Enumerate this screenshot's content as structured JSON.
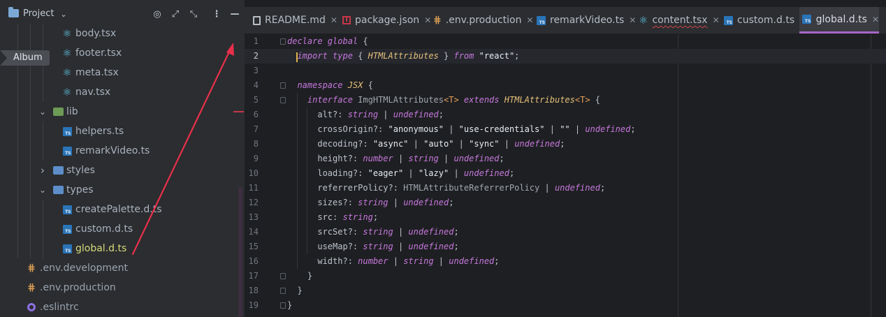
{
  "project": {
    "title": "Project",
    "header_icons": [
      "target-icon",
      "expand-icon",
      "collapse-icon",
      "more-icon",
      "minimize-icon"
    ]
  },
  "tooltip": {
    "label": "Album"
  },
  "tree": [
    {
      "label": "body.tsx",
      "icon": "react",
      "indent": 88
    },
    {
      "label": "footer.tsx",
      "icon": "react",
      "indent": 88
    },
    {
      "label": "meta.tsx",
      "icon": "react",
      "indent": 88
    },
    {
      "label": "nav.tsx",
      "icon": "react",
      "indent": 88
    },
    {
      "label": "lib",
      "icon": "folder-lib",
      "indent": 55,
      "chevron": "v"
    },
    {
      "label": "helpers.ts",
      "icon": "ts",
      "indent": 88
    },
    {
      "label": "remarkVideo.ts",
      "icon": "ts",
      "indent": 88
    },
    {
      "label": "styles",
      "icon": "folder-styles",
      "indent": 55,
      "chevron": ">"
    },
    {
      "label": "types",
      "icon": "folder-types",
      "indent": 55,
      "chevron": "v"
    },
    {
      "label": "createPalette.d.ts",
      "icon": "ts",
      "indent": 88
    },
    {
      "label": "custom.d.ts",
      "icon": "ts",
      "indent": 88
    },
    {
      "label": "global.d.ts",
      "icon": "ts",
      "indent": 88,
      "selected": true
    },
    {
      "label": ".env.development",
      "icon": "env",
      "indent": 37
    },
    {
      "label": ".env.production",
      "icon": "env",
      "indent": 37
    },
    {
      "label": ".eslintrc",
      "icon": "eslint",
      "indent": 37
    }
  ],
  "tabs": [
    {
      "label": "README.md",
      "icon": "readme"
    },
    {
      "label": "package.json",
      "icon": "npm"
    },
    {
      "label": ".env.production",
      "icon": "env"
    },
    {
      "label": "remarkVideo.ts",
      "icon": "ts"
    },
    {
      "label": "content.tsx",
      "icon": "react",
      "error": true
    },
    {
      "label": "custom.d.ts",
      "icon": "ts"
    },
    {
      "label": "global.d.ts",
      "icon": "ts",
      "active": true
    }
  ],
  "editor": {
    "current_line": 2,
    "lines": [
      [
        [
          "kw",
          "declare global"
        ],
        [
          "punc",
          " {"
        ]
      ],
      [
        [
          "punc",
          "  "
        ],
        [
          "kw",
          "import type"
        ],
        [
          "punc",
          " { "
        ],
        [
          "tyy",
          "HTMLAttributes"
        ],
        [
          "punc",
          " } "
        ],
        [
          "kw",
          "from"
        ],
        [
          "str",
          " \"react\""
        ],
        [
          "punc",
          ";"
        ]
      ],
      [],
      [
        [
          "punc",
          "  "
        ],
        [
          "kw",
          "namespace"
        ],
        [
          "punc",
          " "
        ],
        [
          "tyy",
          "JSX"
        ],
        [
          "punc",
          " {"
        ]
      ],
      [
        [
          "punc",
          "    "
        ],
        [
          "kw",
          "interface"
        ],
        [
          "punc",
          " "
        ],
        [
          "tyd",
          "ImgHTMLAttributes"
        ],
        [
          "gen",
          "<T>"
        ],
        [
          "punc",
          " "
        ],
        [
          "kw",
          "extends"
        ],
        [
          "punc",
          " "
        ],
        [
          "tyy",
          "HTMLAttributes"
        ],
        [
          "gen",
          "<T>"
        ],
        [
          "punc",
          " {"
        ]
      ],
      [
        [
          "punc",
          "      alt?: "
        ],
        [
          "ty",
          "string"
        ],
        [
          "punc",
          " | "
        ],
        [
          "ty",
          "undefined"
        ],
        [
          "punc",
          ";"
        ]
      ],
      [
        [
          "punc",
          "      crossOrigin?: "
        ],
        [
          "str",
          "\"anonymous\""
        ],
        [
          "punc",
          " | "
        ],
        [
          "str",
          "\"use-credentials\""
        ],
        [
          "punc",
          " | "
        ],
        [
          "str",
          "\"\""
        ],
        [
          "punc",
          " | "
        ],
        [
          "ty",
          "undefined"
        ],
        [
          "punc",
          ";"
        ]
      ],
      [
        [
          "punc",
          "      decoding?: "
        ],
        [
          "str",
          "\"async\""
        ],
        [
          "punc",
          " | "
        ],
        [
          "str",
          "\"auto\""
        ],
        [
          "punc",
          " | "
        ],
        [
          "str",
          "\"sync\""
        ],
        [
          "punc",
          " | "
        ],
        [
          "ty",
          "undefined"
        ],
        [
          "punc",
          ";"
        ]
      ],
      [
        [
          "punc",
          "      height?: "
        ],
        [
          "ty",
          "number"
        ],
        [
          "punc",
          " | "
        ],
        [
          "ty",
          "string"
        ],
        [
          "punc",
          " | "
        ],
        [
          "ty",
          "undefined"
        ],
        [
          "punc",
          ";"
        ]
      ],
      [
        [
          "punc",
          "      loading?: "
        ],
        [
          "str",
          "\"eager\""
        ],
        [
          "punc",
          " | "
        ],
        [
          "str",
          "\"lazy\""
        ],
        [
          "punc",
          " | "
        ],
        [
          "ty",
          "undefined"
        ],
        [
          "punc",
          ";"
        ]
      ],
      [
        [
          "punc",
          "      referrerPolicy?: "
        ],
        [
          "tyd",
          "HTMLAttributeReferrerPolicy"
        ],
        [
          "punc",
          " | "
        ],
        [
          "ty",
          "undefined"
        ],
        [
          "punc",
          ";"
        ]
      ],
      [
        [
          "punc",
          "      sizes?: "
        ],
        [
          "ty",
          "string"
        ],
        [
          "punc",
          " | "
        ],
        [
          "ty",
          "undefined"
        ],
        [
          "punc",
          ";"
        ]
      ],
      [
        [
          "punc",
          "      src: "
        ],
        [
          "ty",
          "string"
        ],
        [
          "punc",
          ";"
        ]
      ],
      [
        [
          "punc",
          "      srcSet?: "
        ],
        [
          "ty",
          "string"
        ],
        [
          "punc",
          " | "
        ],
        [
          "ty",
          "undefined"
        ],
        [
          "punc",
          ";"
        ]
      ],
      [
        [
          "punc",
          "      useMap?: "
        ],
        [
          "ty",
          "string"
        ],
        [
          "punc",
          " | "
        ],
        [
          "ty",
          "undefined"
        ],
        [
          "punc",
          ";"
        ]
      ],
      [
        [
          "punc",
          "      width?: "
        ],
        [
          "ty",
          "number"
        ],
        [
          "punc",
          " | "
        ],
        [
          "ty",
          "string"
        ],
        [
          "punc",
          " | "
        ],
        [
          "ty",
          "undefined"
        ],
        [
          "punc",
          ";"
        ]
      ],
      [
        [
          "punc",
          "    }"
        ]
      ],
      [
        [
          "punc",
          "  }"
        ]
      ],
      [
        [
          "punc",
          "}"
        ]
      ]
    ]
  }
}
